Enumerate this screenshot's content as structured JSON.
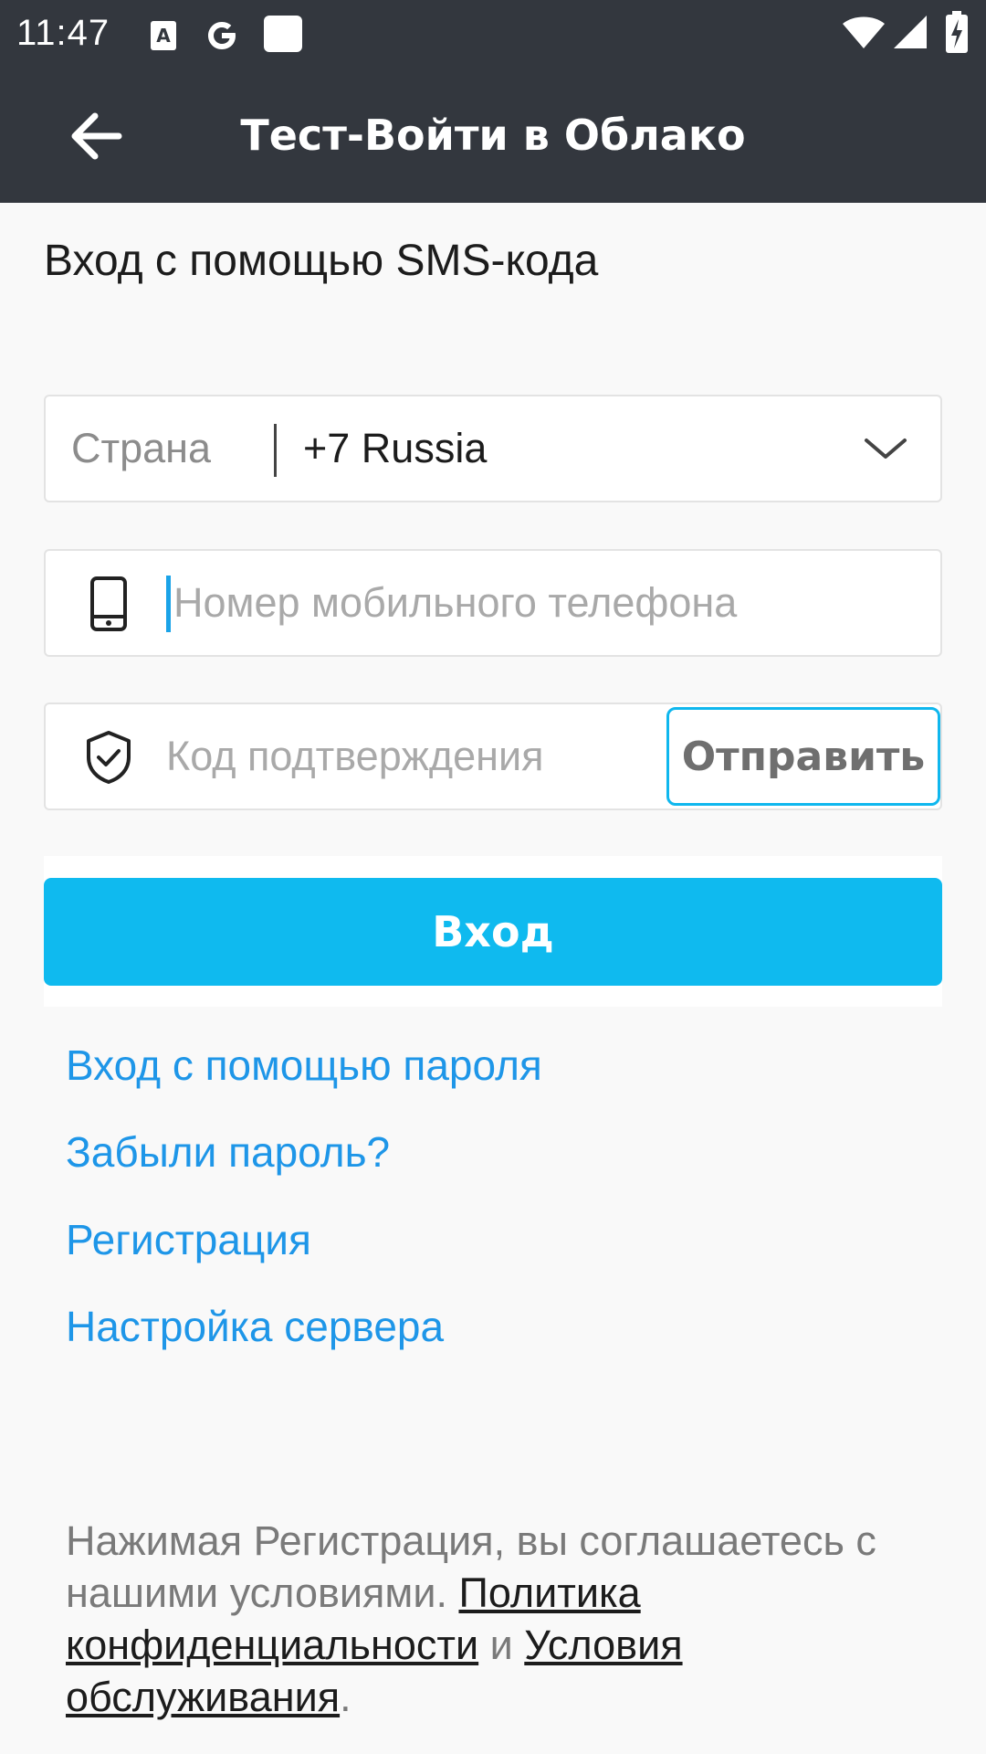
{
  "status_bar": {
    "time": "11:47",
    "icons": [
      "a-notification-icon",
      "google-icon",
      "square-notification-icon",
      "wifi-icon",
      "signal-icon",
      "battery-charging-icon"
    ]
  },
  "app_bar": {
    "title": "Тест-Войти в Облако",
    "back_icon": "arrow-left-icon"
  },
  "form": {
    "heading": "Вход с помощью SMS-кода",
    "country": {
      "label": "Страна",
      "value": "+7 Russia"
    },
    "phone": {
      "placeholder": "Номер мобильного телефона"
    },
    "code": {
      "placeholder": "Код подтверждения",
      "send_label": "Отправить"
    },
    "login_label": "Вход"
  },
  "links": {
    "password_login": "Вход с помощью пароля",
    "forgot_password": "Забыли пароль?",
    "register": "Регистрация",
    "server_settings": "Настройка сервера"
  },
  "terms": {
    "prefix": "Нажимая Регистрация, вы соглашаетесь с нашими условиями. ",
    "privacy_link": "Политика конфиденциальности",
    "conjunction": " и ",
    "terms_link": "Условия обслуживания",
    "suffix": "."
  },
  "colors": {
    "app_bar": "#33373e",
    "accent": "#0fbaef",
    "link": "#1e96e8",
    "background": "#f9f9f9"
  }
}
